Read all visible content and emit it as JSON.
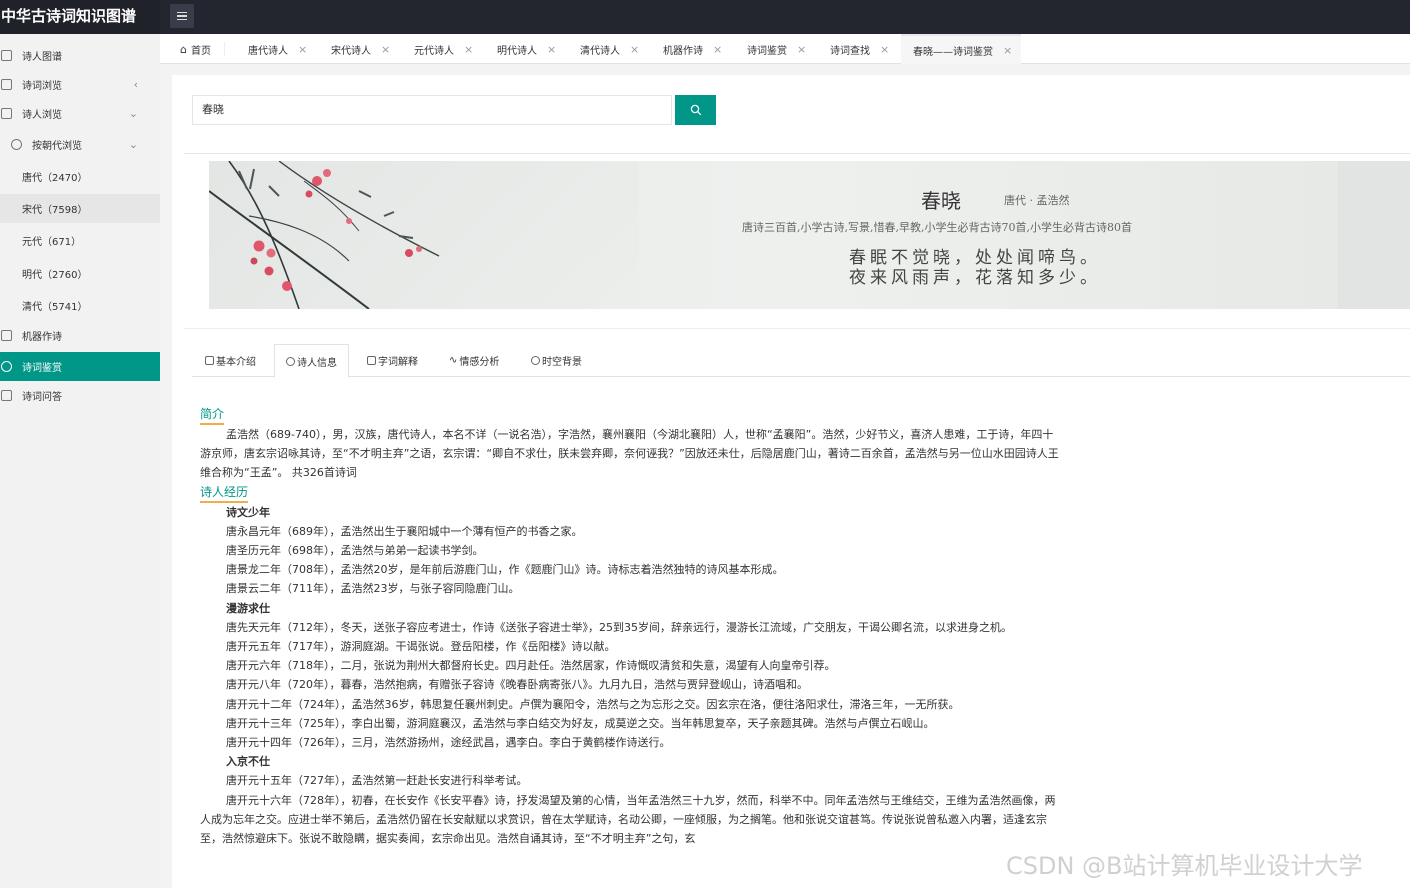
{
  "app": {
    "title": "中华古诗词知识图谱"
  },
  "sidebar": {
    "items": [
      {
        "label": "诗人图谱"
      },
      {
        "label": "诗词浏览"
      },
      {
        "label": "诗人浏览"
      },
      {
        "label": "按朝代浏览"
      },
      {
        "label": "唐代（2470）"
      },
      {
        "label": "宋代（7598）"
      },
      {
        "label": "元代（671）"
      },
      {
        "label": "明代（2760）"
      },
      {
        "label": "清代（5741）"
      },
      {
        "label": "机器作诗"
      },
      {
        "label": "诗词鉴赏"
      },
      {
        "label": "诗词问答"
      }
    ]
  },
  "tabs": [
    {
      "label": "首页"
    },
    {
      "label": "唐代诗人"
    },
    {
      "label": "宋代诗人"
    },
    {
      "label": "元代诗人"
    },
    {
      "label": "明代诗人"
    },
    {
      "label": "清代诗人"
    },
    {
      "label": "机器作诗"
    },
    {
      "label": "诗词鉴赏"
    },
    {
      "label": "诗词查找"
    },
    {
      "label": "春晓——诗词鉴赏"
    }
  ],
  "search": {
    "value": "春晓"
  },
  "poem": {
    "title": "春晓",
    "meta": "唐代 ·  孟浩然",
    "tags": "唐诗三百首,小学古诗,写景,惜春,早教,小学生必背古诗70首,小学生必背古诗80首",
    "lines": [
      "春眠不觉晓，处处闻啼鸟。",
      "夜来风雨声，花落知多少。"
    ]
  },
  "subtabs": [
    {
      "label": "基本介绍"
    },
    {
      "label": "诗人信息"
    },
    {
      "label": "字词解释"
    },
    {
      "label": "情感分析"
    },
    {
      "label": "时空背景"
    }
  ],
  "content": {
    "intro_title": "简介",
    "intro": "孟浩然（689-740），男，汉族，唐代诗人，本名不详（一说名浩），字浩然，襄州襄阳（今湖北襄阳）人，世称“孟襄阳”。浩然，少好节义，喜济人患难，工于诗，年四十游京师，唐玄宗诏咏其诗，至“不才明主弃”之语，玄宗谓：“卿自不求仕，朕未尝弃卿，奈何诬我？”因放还未仕，后隐居鹿门山，著诗二百余首，孟浩然与另一位山水田园诗人王维合称为“王孟”。 共326首诗词",
    "bio_title": "诗人经历",
    "stage1": "诗文少年",
    "p1": "唐永昌元年（689年），孟浩然出生于襄阳城中一个薄有恒产的书香之家。",
    "p2": "唐圣历元年（698年），孟浩然与弟弟一起读书学剑。",
    "p3": "唐景龙二年（708年），孟浩然20岁，是年前后游鹿门山，作《题鹿门山》诗。诗标志着浩然独特的诗风基本形成。",
    "p4": "唐景云二年（711年），孟浩然23岁，与张子容同隐鹿门山。",
    "stage2": "漫游求仕",
    "p5": "唐先天元年（712年），冬天，送张子容应考进士，作诗《送张子容进士举》，25到35岁间，辞亲远行，漫游长江流域，广交朋友，干谒公卿名流，以求进身之机。",
    "p6": "唐开元五年（717年），游洞庭湖。干谒张说。登岳阳楼，作《岳阳楼》诗以献。",
    "p7": "唐开元六年（718年），二月，张说为荆州大都督府长史。四月赴任。浩然居家，作诗慨叹清贫和失意，渴望有人向皇帝引荐。",
    "p8": "唐开元八年（720年），暮春，浩然抱病，有赠张子容诗《晚春卧病寄张八》。九月九日，浩然与贾舁登岘山，诗酒唱和。",
    "p9": "唐开元十二年（724年），孟浩然36岁，韩思复任襄州刺史。卢僎为襄阳令，浩然与之为忘形之交。因玄宗在洛，便往洛阳求仕，滞洛三年，一无所获。",
    "p10": "唐开元十三年（725年），李白出蜀，游洞庭襄汉，孟浩然与李白结交为好友，成莫逆之交。当年韩思复卒，天子亲题其碑。浩然与卢僎立石岘山。",
    "p11": "唐开元十四年（726年），三月，浩然游扬州，途经武昌，遇李白。李白于黄鹤楼作诗送行。",
    "stage3": "入京不仕",
    "p12": "唐开元十五年（727年），孟浩然第一赶赴长安进行科举考试。",
    "p13": "唐开元十六年（728年），初春，在长安作《长安平春》诗，抒发渴望及第的心情，当年孟浩然三十九岁，然而，科举不中。同年孟浩然与王维结交，王维为孟浩然画像，两人成为忘年之交。应进士举不第后，孟浩然仍留在长安献赋以求赏识，曾在太学赋诗，名动公卿，一座倾服，为之搁笔。他和张说交谊甚笃。传说张说曾私邀入内署，适逢玄宗至，浩然惊避床下。张说不敢隐瞒，据实奏闻，玄宗命出见。浩然自诵其诗，至“不才明主弃”之句，玄"
  },
  "watermark": "CSDN @B站计算机毕业设计大学",
  "colors": {
    "accent": "#009688",
    "header": "#23262e",
    "underline": "#f0ad4e"
  }
}
